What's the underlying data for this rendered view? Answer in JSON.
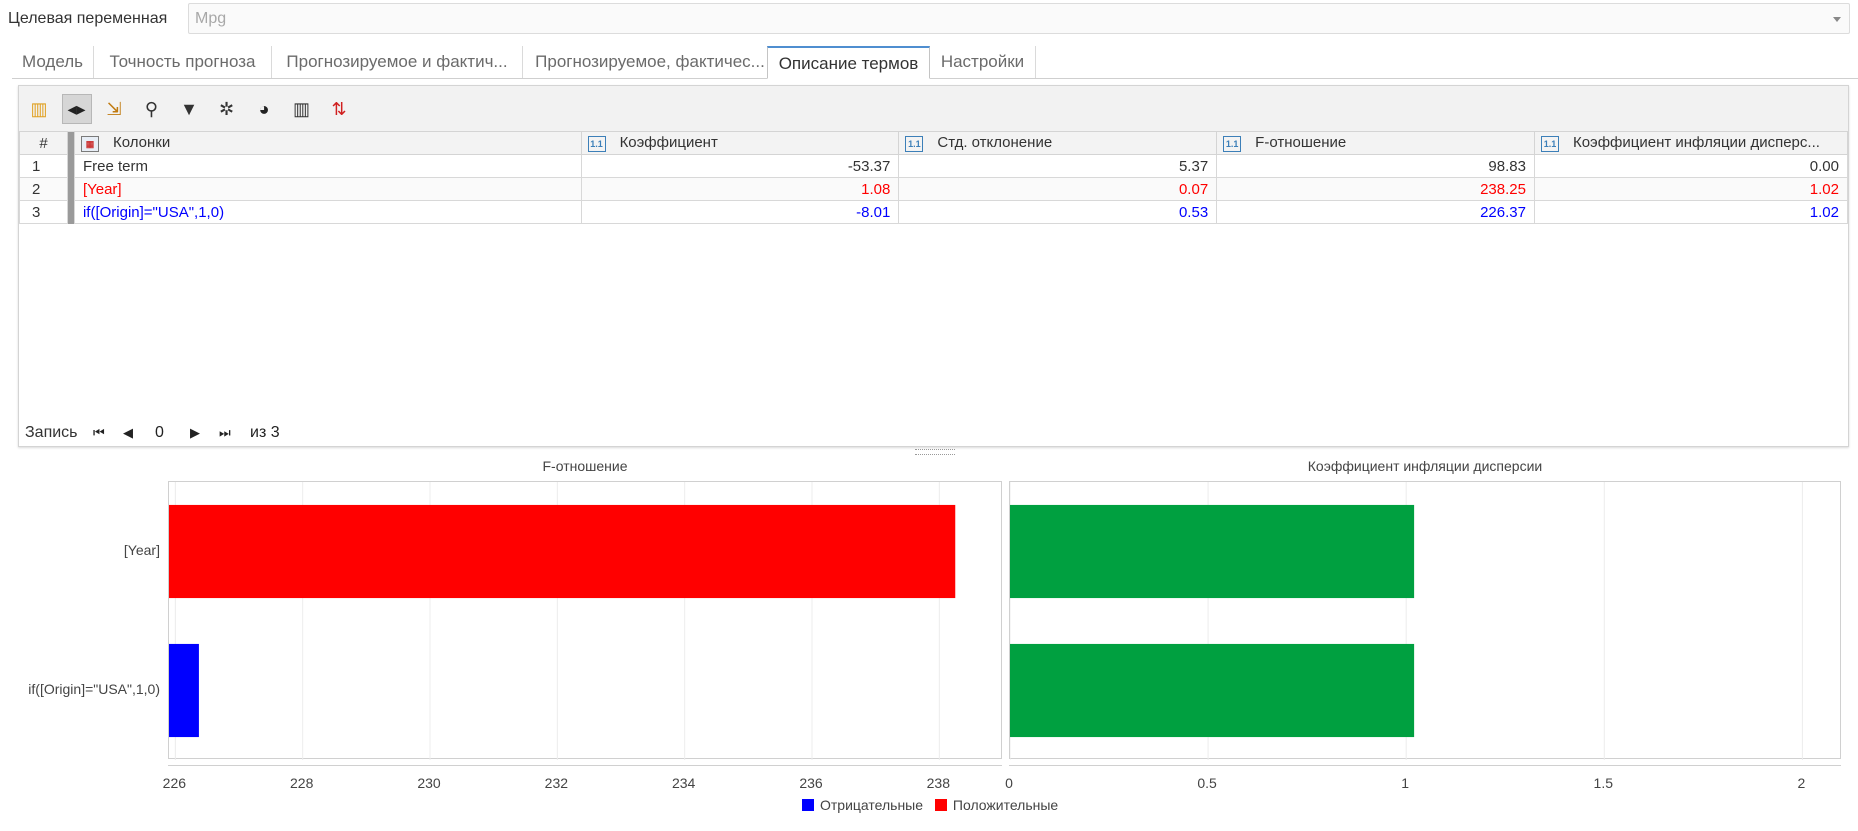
{
  "target": {
    "label": "Целевая переменная",
    "value": "Mpg"
  },
  "tabs": [
    {
      "label": "Модель",
      "active": false
    },
    {
      "label": "Точность прогноза",
      "active": false
    },
    {
      "label": "Прогнозируемое и фактич...",
      "active": false
    },
    {
      "label": "Прогнозируемое, фактичес...",
      "active": false
    },
    {
      "label": "Описание термов",
      "active": true
    },
    {
      "label": "Настройки",
      "active": false
    }
  ],
  "toolbar": {
    "buttons": [
      {
        "icon": "columns-icon",
        "glyph": "▥",
        "color": "#e0a020"
      },
      {
        "icon": "fit-columns-icon",
        "glyph": "◂▸",
        "color": "#222",
        "active": true
      },
      {
        "icon": "clear-sort-icon",
        "glyph": "⇲",
        "color": "#c07a10"
      },
      {
        "icon": "find-icon",
        "glyph": "⚲",
        "color": "#333"
      },
      {
        "icon": "filter-icon",
        "glyph": "▼",
        "color": "#333"
      },
      {
        "icon": "settings-icon",
        "glyph": "✲",
        "color": "#333"
      },
      {
        "icon": "palette-icon",
        "glyph": "◕",
        "color": "#222"
      },
      {
        "icon": "bar-chart-icon",
        "glyph": "▥",
        "color": "#333"
      },
      {
        "icon": "sort-icon",
        "glyph": "⇅",
        "color": "#d02020"
      }
    ]
  },
  "table": {
    "headers": {
      "index": "#",
      "columns": "Колонки",
      "coef": "Коэффициент",
      "std": "Стд. отклонение",
      "f": "F-отношение",
      "vif": "Коэффициент инфляции дисперс..."
    },
    "type_badge": "1.1",
    "rows": [
      {
        "idx": "1",
        "name": "Free term",
        "coef": "-53.37",
        "std": "5.37",
        "f": "98.83",
        "vif": "0.00"
      },
      {
        "idx": "2",
        "name": "[Year]",
        "coef": "1.08",
        "std": "0.07",
        "f": "238.25",
        "vif": "1.02"
      },
      {
        "idx": "3",
        "name": "if([Origin]=\"USA\",1,0)",
        "coef": "-8.01",
        "std": "0.53",
        "f": "226.37",
        "vif": "1.02"
      }
    ]
  },
  "pager": {
    "label": "Запись",
    "current": "0",
    "of": "из 3"
  },
  "chart_data": [
    {
      "type": "bar",
      "orientation": "horizontal",
      "title": "F-отношение",
      "categories": [
        "[Year]",
        "if([Origin]=\"USA\",1,0)"
      ],
      "values": [
        238.25,
        226.37
      ],
      "bar_colors": [
        "#ff0000",
        "#0000ff"
      ],
      "xlim": [
        225.9,
        239.0
      ],
      "xticks": [
        226,
        228,
        230,
        232,
        234,
        236,
        238
      ],
      "grid": true
    },
    {
      "type": "bar",
      "orientation": "horizontal",
      "title": "Коэффициент инфляции дисперсии",
      "categories": [
        "[Year]",
        "if([Origin]=\"USA\",1,0)"
      ],
      "values": [
        1.02,
        1.02
      ],
      "bar_colors": [
        "#00a040",
        "#00a040"
      ],
      "xlim": [
        0,
        2.1
      ],
      "xticks": [
        0,
        0.5,
        1,
        1.5,
        2
      ],
      "grid": true
    }
  ],
  "legend": [
    {
      "label": "Отрицательные",
      "color": "#0000ff"
    },
    {
      "label": "Положительные",
      "color": "#ff0000"
    }
  ]
}
